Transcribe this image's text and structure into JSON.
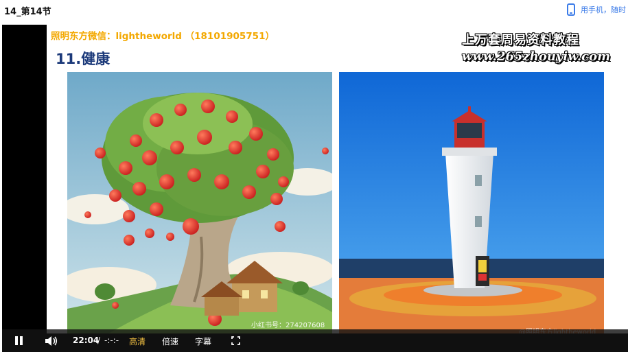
{
  "window": {
    "title": "14_第14节",
    "phone_link": "用手机，随时"
  },
  "slide": {
    "contact": "照明东方微信：lightheworld （18101905751）",
    "watermark_line1": "上万套周易资料教程",
    "watermark_line2": "www.265zhouyiw.com",
    "heading": "11.健康",
    "image1_caption": "小红书号：274207608",
    "image2_caption": "@照明东方lightheworld"
  },
  "controls": {
    "time_current": "22:04",
    "time_sep": "/",
    "time_total": "-:-:-",
    "quality": "高清",
    "speed": "倍速",
    "subtitles": "字幕"
  },
  "colors": {
    "quality_active": "#f5c242",
    "contact": "#f3a800",
    "heading": "#1c3a7a",
    "link": "#3b7be8"
  }
}
